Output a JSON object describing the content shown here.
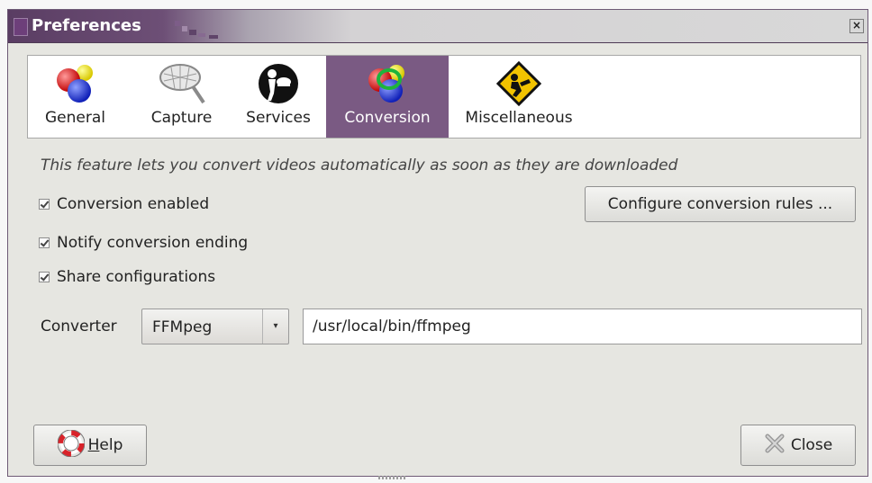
{
  "window": {
    "title": "Preferences",
    "close_glyph": "×"
  },
  "tabs": [
    {
      "label": "General",
      "icon": "color-balls-icon"
    },
    {
      "label": "Capture",
      "icon": "net-icon"
    },
    {
      "label": "Services",
      "icon": "waiter-icon"
    },
    {
      "label": "Conversion",
      "icon": "conversion-balls-icon",
      "active": true
    },
    {
      "label": "Miscellaneous",
      "icon": "warning-sign-icon"
    }
  ],
  "description": "This feature lets you convert videos automatically as soon as they are downloaded",
  "options": {
    "conversion_enabled": {
      "label": "Conversion enabled",
      "checked": true
    },
    "notify_ending": {
      "label": "Notify conversion ending",
      "checked": true
    },
    "share_configs": {
      "label": "Share configurations",
      "checked": true
    }
  },
  "configure_button": "Configure conversion rules ...",
  "converter": {
    "label": "Converter",
    "selected": "FFMpeg",
    "dropdown_glyph": "▾",
    "path": "/usr/local/bin/ffmpeg"
  },
  "buttons": {
    "help_rest": "elp",
    "help_mnemonic": "H",
    "close": "Close"
  },
  "colors": {
    "accent": "#7a5a83",
    "window_bg": "#e6e6e1",
    "titlebar": "#5a3d63"
  }
}
